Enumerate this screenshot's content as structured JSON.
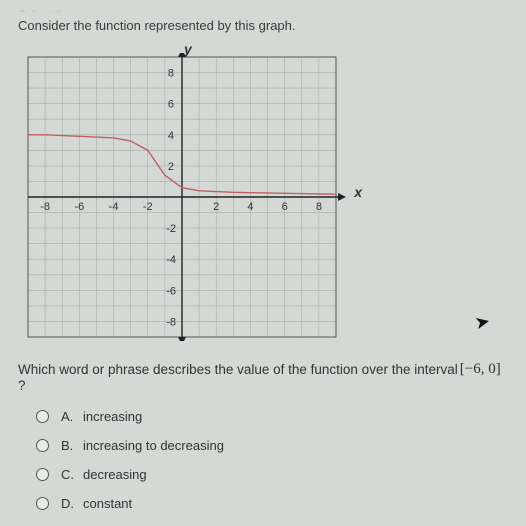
{
  "header_truncated": "Select the correct answer.",
  "prompt": "Consider the function represented by this graph.",
  "axis": {
    "y": "y",
    "x": "x"
  },
  "ticks_x": [
    "-8",
    "-6",
    "-4",
    "-2",
    "2",
    "4",
    "6",
    "8"
  ],
  "ticks_y_pos": [
    "2",
    "4",
    "6",
    "8"
  ],
  "ticks_y_neg": [
    "-2",
    "-4",
    "-6",
    "-8"
  ],
  "question_prefix": "Which word or phrase describes the value of the function over the interval",
  "interval": "[−6, 0]",
  "question_suffix": "?",
  "options": [
    {
      "letter": "A.",
      "text": "increasing"
    },
    {
      "letter": "B.",
      "text": "increasing to decreasing"
    },
    {
      "letter": "C.",
      "text": "decreasing"
    },
    {
      "letter": "D.",
      "text": "constant"
    }
  ],
  "chart_data": {
    "type": "line",
    "title": "",
    "xlabel": "x",
    "ylabel": "y",
    "xlim": [
      -9,
      9
    ],
    "ylim": [
      -9,
      9
    ],
    "series": [
      {
        "name": "function",
        "x": [
          -9,
          -8,
          -7,
          -6,
          -5,
          -4,
          -3,
          -2,
          -1,
          0,
          1,
          2,
          3,
          4,
          5,
          6,
          7,
          8,
          9
        ],
        "values": [
          4.0,
          4.0,
          3.95,
          3.9,
          3.85,
          3.8,
          3.6,
          3.0,
          1.4,
          0.6,
          0.4,
          0.35,
          0.3,
          0.28,
          0.26,
          0.24,
          0.22,
          0.2,
          0.18
        ]
      }
    ]
  }
}
